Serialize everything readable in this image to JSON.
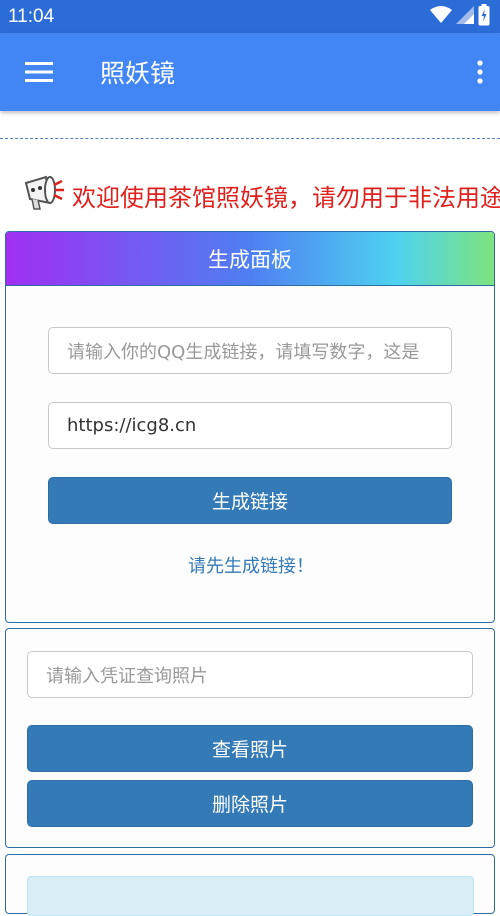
{
  "status_bar": {
    "time": "11:04"
  },
  "app_bar": {
    "title": "照妖镜"
  },
  "notice": {
    "text": "欢迎使用茶馆照妖镜，请勿用于非法用途"
  },
  "panel_generate": {
    "heading": "生成面板",
    "qq_input_placeholder": "请输入你的QQ生成链接，请填写数字，这是",
    "url_input_value": "https://icg8.cn",
    "generate_button": "生成链接",
    "hint": "请先生成链接！"
  },
  "panel_query": {
    "voucher_input_placeholder": "请输入凭证查询照片",
    "view_button": "查看照片",
    "delete_button": "删除照片"
  },
  "colors": {
    "status_bar": "#2c6cd6",
    "app_bar": "#4285f4",
    "button": "#337ab7",
    "notice_text": "#e0201c"
  }
}
